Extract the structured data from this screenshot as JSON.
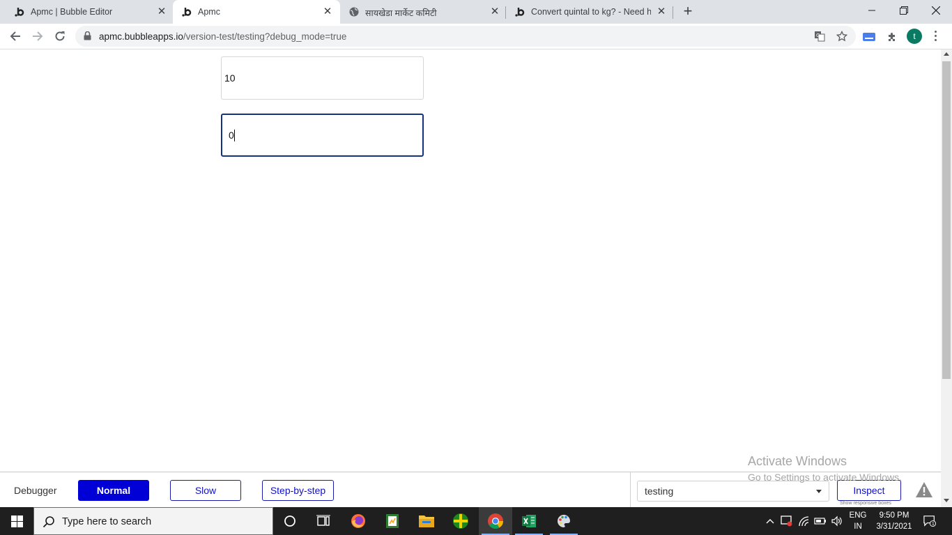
{
  "browser": {
    "tabs": [
      {
        "title": "Apmc | Bubble Editor",
        "favicon": "bubble-icon",
        "active": false
      },
      {
        "title": "Apmc",
        "favicon": "bubble-icon",
        "active": true
      },
      {
        "title": "सायखेडा मार्केट कमिटी",
        "favicon": "globe-icon",
        "active": false
      },
      {
        "title": "Convert quintal to kg? - Need he",
        "favicon": "bubble-icon",
        "active": false
      }
    ],
    "url_host": "apmc.bubbleapps.io",
    "url_path": "/version-test/testing?debug_mode=true",
    "profile_initial": "t"
  },
  "page": {
    "input1_value": "10",
    "input2_value": "0"
  },
  "debugger": {
    "label": "Debugger",
    "modes": [
      "Normal",
      "Slow",
      "Step-by-step"
    ],
    "active_mode": "Normal",
    "page_select_value": "testing",
    "inspect_label": "Inspect",
    "responsive_note": "Show responsive boxes"
  },
  "watermark": {
    "line1": "Activate Windows",
    "line2": "Go to Settings to activate Windows."
  },
  "taskbar": {
    "search_placeholder": "Type here to search",
    "lang_line1": "ENG",
    "lang_line2": "IN",
    "time": "9:50 PM",
    "date": "3/31/2021",
    "notification_count": "1"
  },
  "colors": {
    "debugger_accent": "#0000d6",
    "focus_border": "#15317e",
    "taskbar_bg": "#1f1f1f"
  }
}
